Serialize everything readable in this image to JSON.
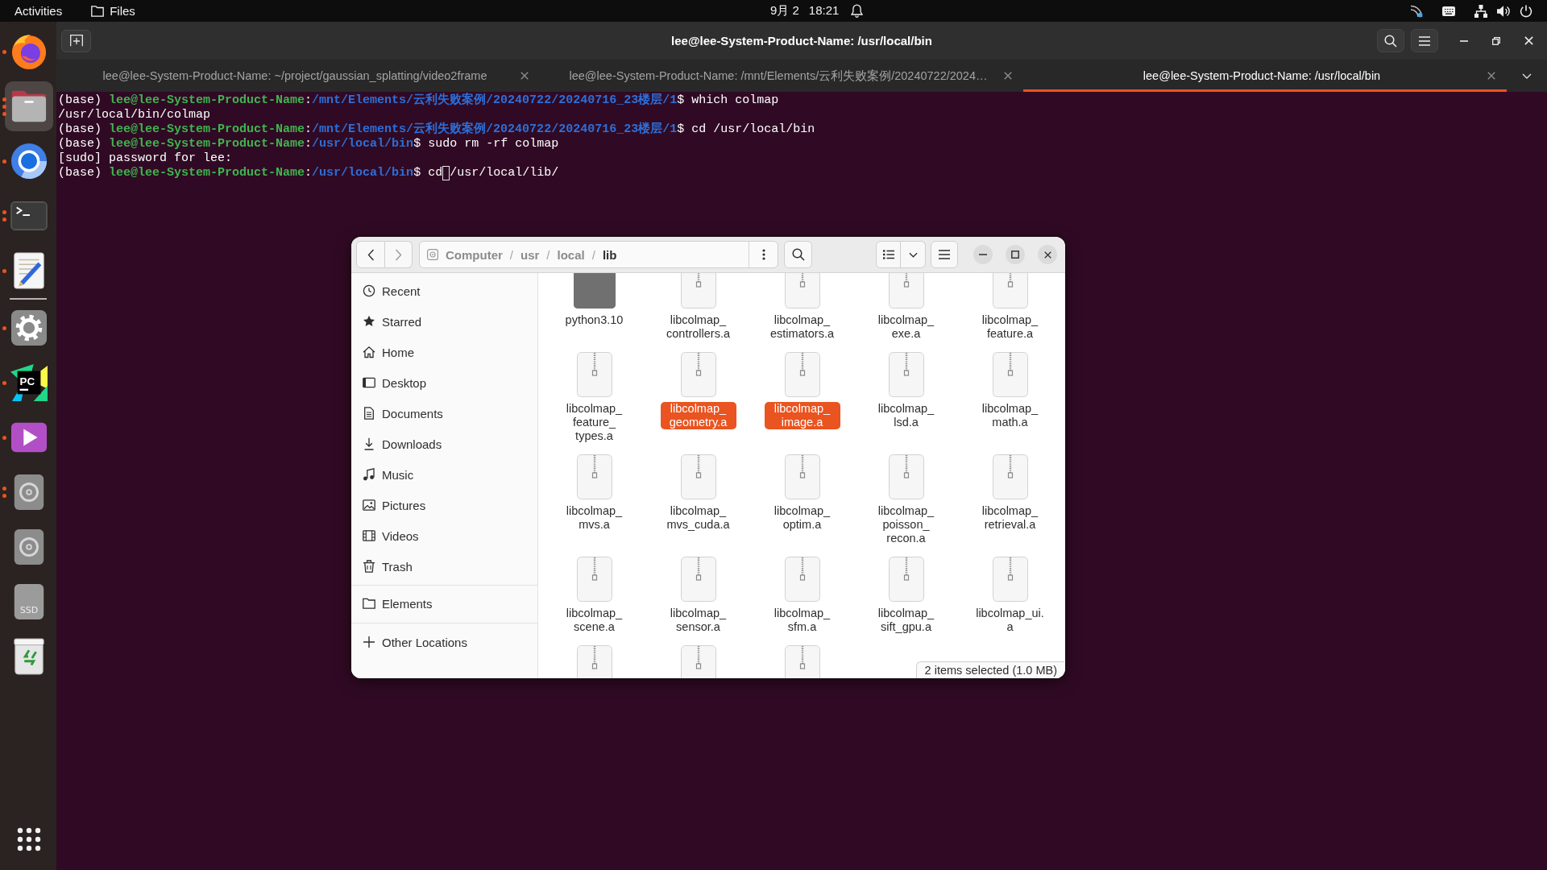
{
  "top_bar": {
    "activities": "Activities",
    "app_menu": "Files",
    "clock": {
      "date": "9月 2",
      "time": "18:21"
    }
  },
  "dock": {
    "pinned": [
      {
        "kind": "web",
        "windows": [
          {
            "kind": "window"
          }
        ],
        "focused": false
      },
      {
        "kind": "files",
        "windows": [
          {
            "kind": "window"
          },
          {
            "kind": "window"
          },
          {
            "kind": "window"
          }
        ],
        "focused": true
      },
      {
        "kind": "web2",
        "windows": [
          {
            "kind": "window"
          }
        ],
        "focused": false
      },
      {
        "kind": "terminal",
        "windows": [
          {
            "kind": "window"
          },
          {
            "kind": "window"
          }
        ],
        "focused": false
      },
      {
        "kind": "editor",
        "windows": [
          {
            "kind": "window"
          }
        ],
        "focused": false
      }
    ],
    "others": [
      {
        "kind": "settings",
        "windows": [
          {
            "kind": "window"
          }
        ],
        "focused": false
      },
      {
        "kind": "ide",
        "text": "PC",
        "windows": [
          {
            "kind": "window"
          }
        ],
        "focused": false
      },
      {
        "kind": "player",
        "windows": [
          {
            "kind": "window"
          }
        ],
        "focused": false
      },
      {
        "kind": "disc",
        "windows": [
          {
            "kind": "window"
          },
          {
            "kind": "window"
          }
        ],
        "focused": false
      },
      {
        "kind": "disc",
        "focused": false
      },
      {
        "kind": "drive",
        "text": "SSD",
        "focused": false
      },
      {
        "kind": "trash",
        "focused": false
      }
    ]
  },
  "terminal": {
    "title": "lee@lee-System-Product-Name: /usr/local/bin",
    "tabs": [
      {
        "label": "lee@lee-System-Product-Name: ~/project/gaussian_splatting/video2frame",
        "selected": false
      },
      {
        "label": "lee@lee-System-Product-Name: /mnt/Elements/云利失败案例/20240722/2024…",
        "selected": false
      },
      {
        "label": "lee@lee-System-Product-Name: /usr/local/bin",
        "selected": true
      }
    ],
    "lines": [
      {
        "kind": "prompt",
        "env": "(base)",
        "user": "lee@lee-System-Product-Name",
        "separator": ":",
        "path": "/mnt/Elements/云利失败案例/20240722/20240716_23楼层/1",
        "symbol": "$",
        "command": "which colmap",
        "cursor": false
      },
      {
        "kind": "output",
        "text": "/usr/local/bin/colmap",
        "cursor": false
      },
      {
        "kind": "prompt",
        "env": "(base)",
        "user": "lee@lee-System-Product-Name",
        "separator": ":",
        "path": "/mnt/Elements/云利失败案例/20240722/20240716_23楼层/1",
        "symbol": "$",
        "command": "cd /usr/local/bin",
        "cursor": false
      },
      {
        "kind": "prompt",
        "env": "(base)",
        "user": "lee@lee-System-Product-Name",
        "separator": ":",
        "path": "/usr/local/bin",
        "symbol": "$",
        "command": "sudo rm -rf colmap",
        "cursor": false
      },
      {
        "kind": "output",
        "text": "[sudo] password for lee:",
        "cursor": false
      },
      {
        "kind": "prompt",
        "env": "(base)",
        "user": "lee@lee-System-Product-Name",
        "separator": ":",
        "path": "/usr/local/bin",
        "symbol": "$",
        "command": "cd",
        "cursor": true,
        "after_cursor": "/usr/local/lib/"
      }
    ]
  },
  "file_manager": {
    "path": [
      {
        "label": "Computer",
        "current": false
      },
      {
        "separator": "/",
        "label": "usr",
        "current": false
      },
      {
        "separator": "/",
        "label": "local",
        "current": false
      },
      {
        "separator": "/",
        "label": "lib",
        "current": true
      }
    ],
    "sidebar": {
      "sections": [
        {
          "items": [
            {
              "label": "Recent",
              "kind": "recent",
              "selected": false
            },
            {
              "label": "Starred",
              "kind": "starred",
              "selected": false
            },
            {
              "label": "Home",
              "kind": "home",
              "selected": false
            },
            {
              "label": "Desktop",
              "kind": "desktop",
              "selected": false
            },
            {
              "label": "Documents",
              "kind": "documents",
              "selected": false
            },
            {
              "label": "Downloads",
              "kind": "downloads",
              "selected": false
            },
            {
              "label": "Music",
              "kind": "music",
              "selected": false
            },
            {
              "label": "Pictures",
              "kind": "pictures",
              "selected": false
            },
            {
              "label": "Videos",
              "kind": "videos",
              "selected": false
            },
            {
              "label": "Trash",
              "kind": "trash",
              "selected": false
            }
          ]
        },
        {
          "items": [
            {
              "label": "Elements",
              "kind": "volume",
              "selected": false
            }
          ]
        },
        {
          "items": [
            {
              "label": "Other Locations",
              "kind": "other",
              "selected": false
            }
          ]
        }
      ]
    },
    "items": [
      {
        "name": "python3.10",
        "kind": "folder",
        "selected": false
      },
      {
        "name": "libcolmap_controllers.a",
        "kind": "archive",
        "selected": false
      },
      {
        "name": "libcolmap_estimators.a",
        "kind": "archive",
        "selected": false
      },
      {
        "name": "libcolmap_exe.a",
        "kind": "archive",
        "selected": false
      },
      {
        "name": "libcolmap_feature.a",
        "kind": "archive",
        "selected": false
      },
      {
        "name": "libcolmap_feature_types.a",
        "kind": "archive",
        "selected": false
      },
      {
        "name": "libcolmap_geometry.a",
        "kind": "archive",
        "selected": true
      },
      {
        "name": "libcolmap_image.a",
        "kind": "archive",
        "selected": true
      },
      {
        "name": "libcolmap_lsd.a",
        "kind": "archive",
        "selected": false
      },
      {
        "name": "libcolmap_math.a",
        "kind": "archive",
        "selected": false
      },
      {
        "name": "libcolmap_mvs.a",
        "kind": "archive",
        "selected": false
      },
      {
        "name": "libcolmap_mvs_cuda.a",
        "kind": "archive",
        "selected": false
      },
      {
        "name": "libcolmap_optim.a",
        "kind": "archive",
        "selected": false
      },
      {
        "name": "libcolmap_poisson_recon.a",
        "kind": "archive",
        "selected": false
      },
      {
        "name": "libcolmap_retrieval.a",
        "kind": "archive",
        "selected": false
      },
      {
        "name": "libcolmap_scene.a",
        "kind": "archive",
        "selected": false
      },
      {
        "name": "libcolmap_sensor.a",
        "kind": "archive",
        "selected": false
      },
      {
        "name": "libcolmap_sfm.a",
        "kind": "archive",
        "selected": false
      },
      {
        "name": "libcolmap_sift_gpu.a",
        "kind": "archive",
        "selected": false
      },
      {
        "name": "libcolmap_ui.a",
        "kind": "archive",
        "selected": false
      },
      {
        "kind": "archive",
        "selected": false
      },
      {
        "kind": "archive",
        "selected": false
      },
      {
        "kind": "archive",
        "selected": false
      }
    ],
    "status": "2 items selected (1.0 MB)"
  }
}
